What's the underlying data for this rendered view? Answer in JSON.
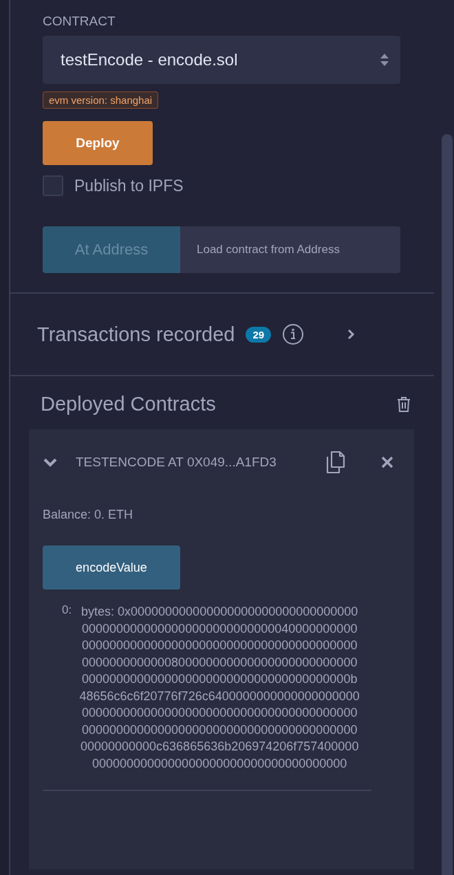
{
  "contract": {
    "label": "CONTRACT",
    "selected_value": "testEncode - encode.sol",
    "evm_badge": "evm version: shanghai"
  },
  "deploy_button": "Deploy",
  "publish": {
    "label": "Publish to IPFS",
    "checked": false
  },
  "at_address": {
    "button": "At Address",
    "placeholder": "Load contract from Address"
  },
  "transactions": {
    "title": "Transactions recorded",
    "count": "29"
  },
  "deployed": {
    "title": "Deployed Contracts",
    "instances": [
      {
        "title": "TESTENCODE AT 0X049...A1FD3",
        "expanded": true,
        "balance": "Balance: 0. ETH",
        "functions": [
          {
            "name": "encodeValue"
          }
        ],
        "outputs": [
          {
            "index": "0:",
            "value": "bytes: 0x000000000000000000000000000000000000000000000000000000000000004000000000000000000000000000000000000000000000000000000000000000800000000000000000000000000000000000000000000000000000000000000000b48656c6c6f20776f726c64000000000000000000000000000000000000000000000000000000000000000000000000000000000000000000000000000000000000000c636865636b206974206f7574000000000000000000000000000000000000000000"
          }
        ]
      }
    ]
  }
}
